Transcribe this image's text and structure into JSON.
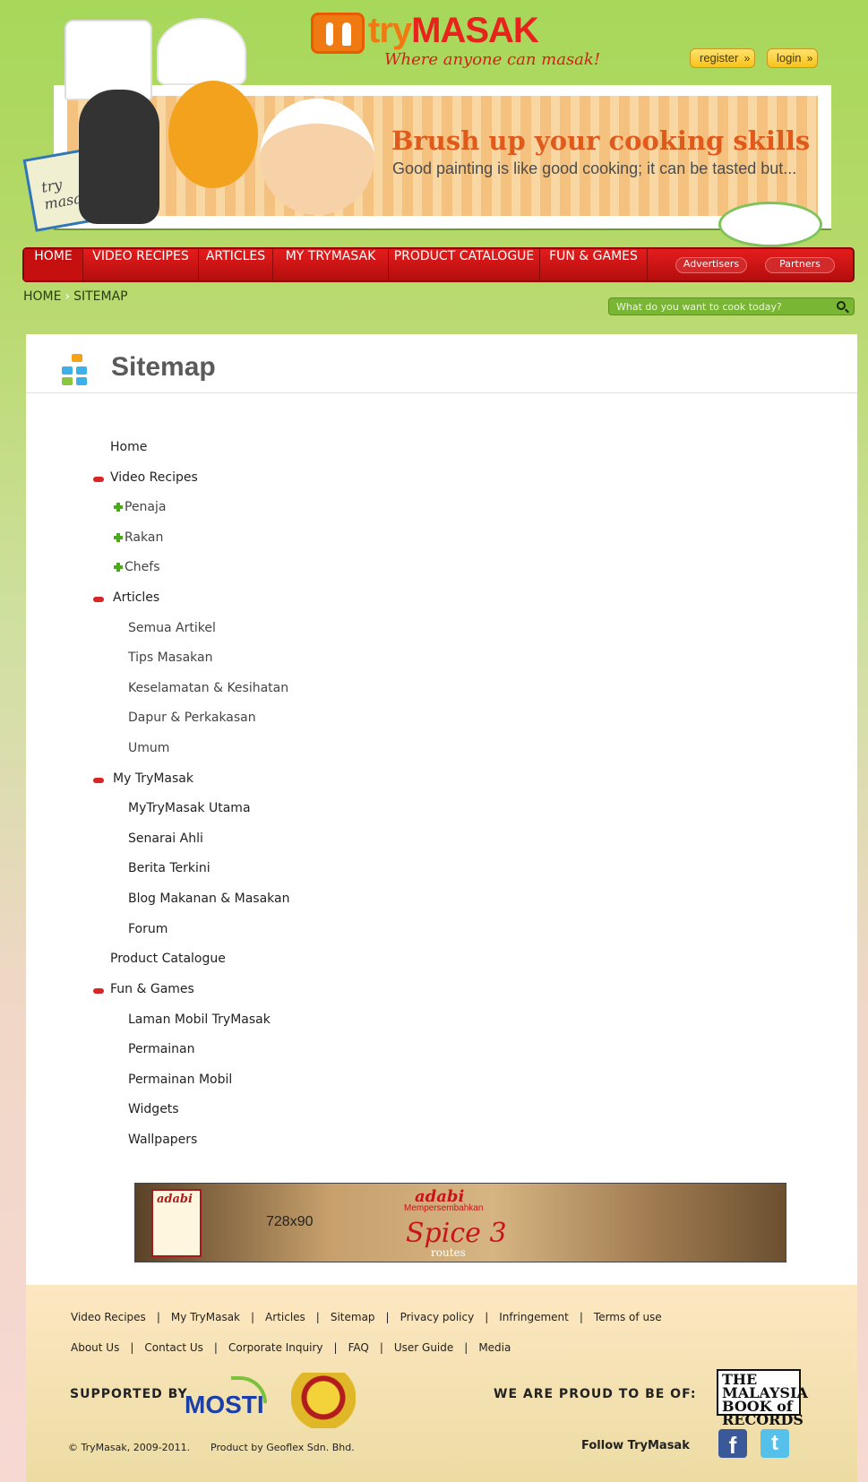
{
  "header": {
    "logo_try": "try",
    "logo_masak": "MASAK",
    "tagline": "Where anyone can masak!",
    "register_label": "register",
    "login_label": "login"
  },
  "banner": {
    "title": "Brush up your cooking skills",
    "subtitle": "Good painting is like good cooking; it can be tasted but...",
    "book_text": "try masak"
  },
  "nav": {
    "items": [
      "HOME",
      "VIDEO RECIPES",
      "ARTICLES",
      "MY TRYMASAK",
      "PRODUCT CATALOGUE",
      "FUN & GAMES"
    ],
    "advertisers": "Advertisers",
    "partners": "Partners"
  },
  "breadcrumb": {
    "home": "HOME",
    "current": "SITEMAP"
  },
  "search": {
    "placeholder": "What do you want to cook today?"
  },
  "page": {
    "title": "Sitemap"
  },
  "sitemap": {
    "home": "Home",
    "video_recipes": "Video Recipes",
    "video_children": [
      "Penaja",
      "Rakan",
      "Chefs"
    ],
    "articles": "Articles",
    "articles_children": [
      "Semua Artikel",
      "Tips Masakan",
      "Keselamatan & Kesihatan",
      "Dapur & Perkakasan",
      "Umum"
    ],
    "my_trymasak": "My TryMasak",
    "my_children": [
      "MyTryMasak Utama",
      "Senarai Ahli",
      "Berita Terkini",
      "Blog Makanan & Masakan",
      "Forum"
    ],
    "product_catalogue": "Product Catalogue",
    "fun_games": "Fun & Games",
    "fun_children": [
      "Laman Mobil TryMasak",
      "Permainan",
      "Permainan Mobil",
      "Widgets",
      "Wallpapers"
    ]
  },
  "ad": {
    "size_label": "728x90",
    "brand": "adabi",
    "sub": "Mempersembahkan",
    "spice": "Spice 3",
    "routes": "routes"
  },
  "footer": {
    "links_row1": [
      "Video Recipes",
      "My TryMasak",
      "Articles",
      "Sitemap",
      "Privacy policy",
      "Infringement",
      "Terms of use"
    ],
    "links_row2": [
      "About Us",
      "Contact Us",
      "Corporate Inquiry",
      "FAQ",
      "User Guide",
      "Media"
    ],
    "supported_by": "SUPPORTED BY",
    "mosti": "MOSTI",
    "proud": "WE ARE PROUD TO BE OF:",
    "mbr": "THE MALAYSIA BOOK of RECORDS",
    "copyright": "© TryMasak, 2009-2011.",
    "product_by": "Product by Geoflex Sdn. Bhd.",
    "follow": "Follow TryMasak",
    "facebook": "f",
    "twitter": "t"
  }
}
